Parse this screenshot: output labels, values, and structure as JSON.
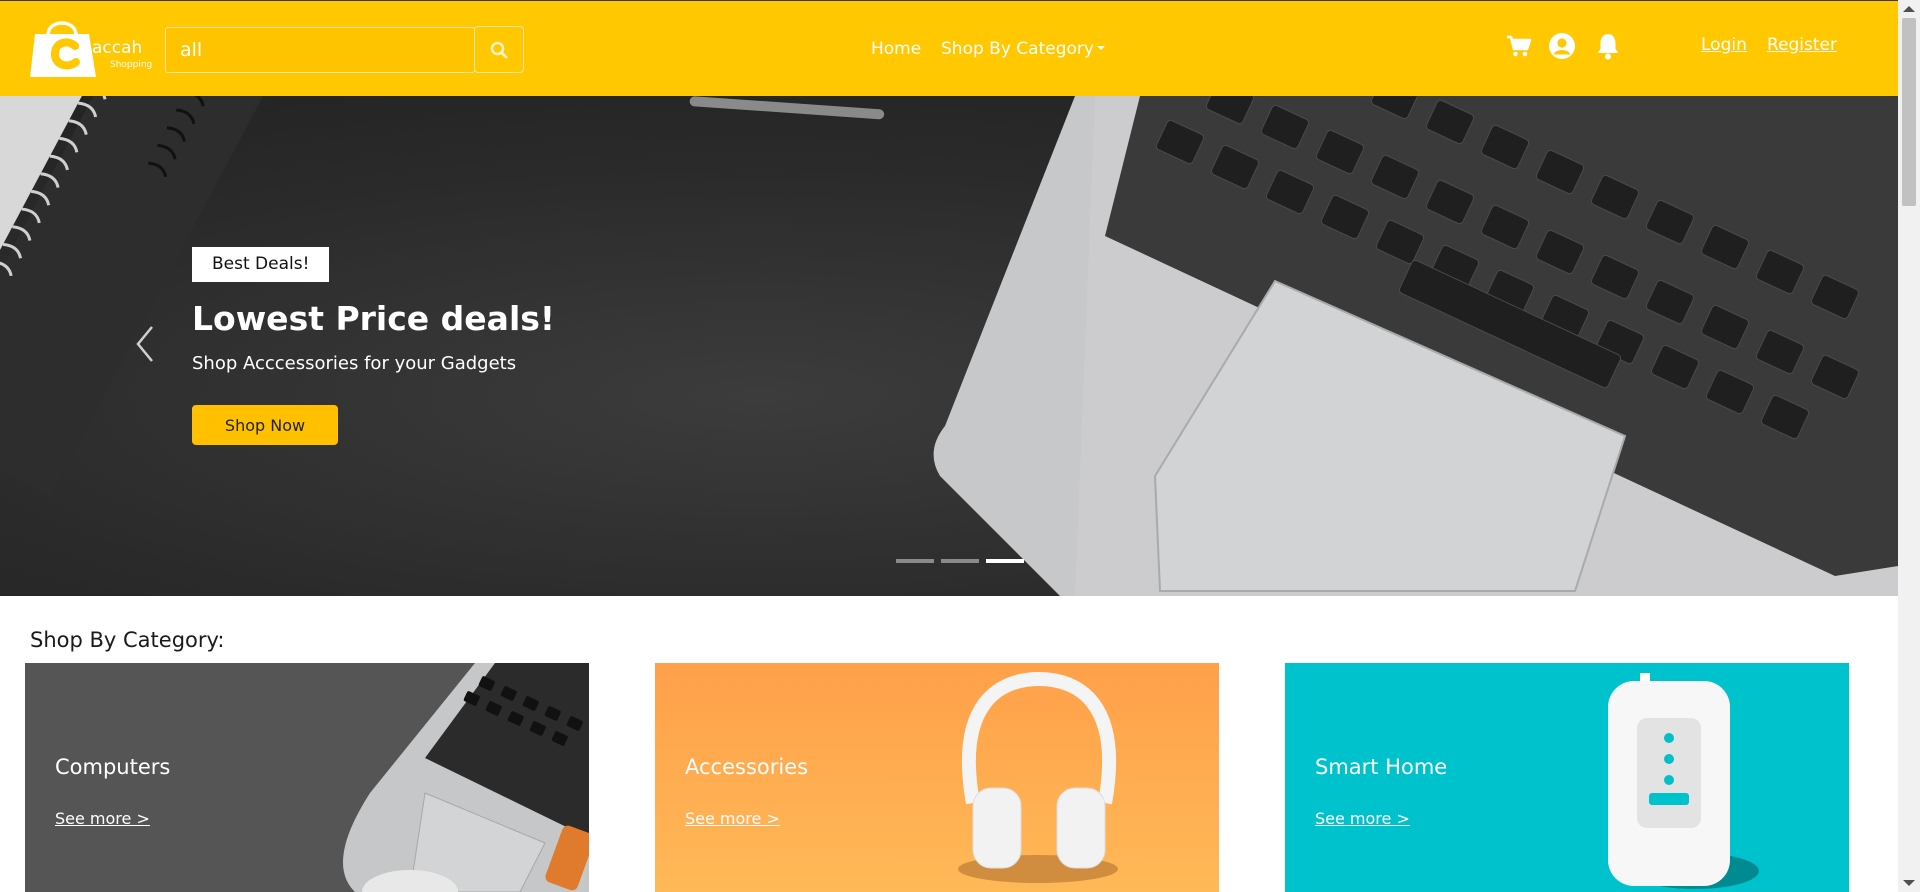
{
  "brand": {
    "name": "accah",
    "tagline": "Shopping",
    "logo_letter": "C",
    "primary_color": "#ffc800"
  },
  "search": {
    "value": "all",
    "icon": "search-icon"
  },
  "nav": {
    "home": "Home",
    "shop_by_category": "Shop By Category"
  },
  "header_icons": [
    "cart-icon",
    "user-circle-icon",
    "bell-icon"
  ],
  "auth": {
    "login": "Login",
    "register": "Register"
  },
  "hero": {
    "badge": "Best Deals!",
    "title": "Lowest Price deals!",
    "subtitle": "Shop Acccessories for your Gadgets",
    "cta": "Shop Now",
    "slide_count": 3,
    "active_slide": 3
  },
  "categories": {
    "title": "Shop By Category:",
    "items": [
      {
        "name": "Computers",
        "link": "See more >",
        "color": "#555555"
      },
      {
        "name": "Accessories",
        "link": "See more >",
        "color": "#ffa94f"
      },
      {
        "name": "Smart Home",
        "link": "See more >",
        "color": "#00c2cc"
      }
    ]
  }
}
